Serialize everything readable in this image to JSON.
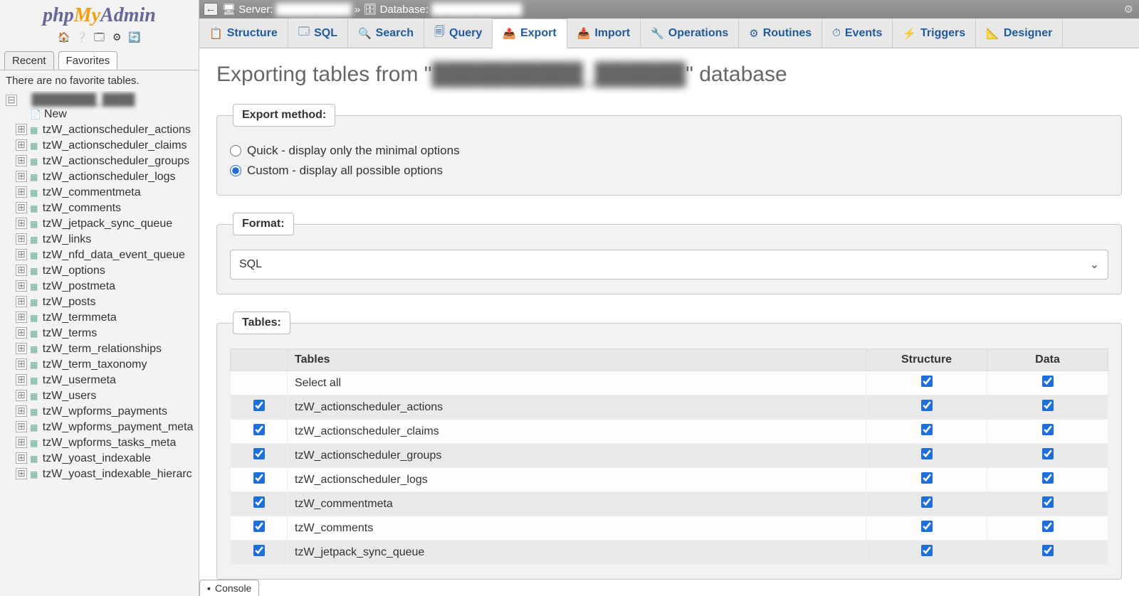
{
  "logo": {
    "part1": "php",
    "part2": "My",
    "part3": "Admin"
  },
  "sidebar": {
    "mini_icons": [
      "home",
      "help",
      "sql",
      "settings",
      "reload"
    ],
    "tabs": {
      "recent": "Recent",
      "favorites": "Favorites"
    },
    "favorites_message": "There are no favorite tables.",
    "db_name_blurred": "████████_████",
    "new_label": "New",
    "tables": [
      "tzW_actionscheduler_actions",
      "tzW_actionscheduler_claims",
      "tzW_actionscheduler_groups",
      "tzW_actionscheduler_logs",
      "tzW_commentmeta",
      "tzW_comments",
      "tzW_jetpack_sync_queue",
      "tzW_links",
      "tzW_nfd_data_event_queue",
      "tzW_options",
      "tzW_postmeta",
      "tzW_posts",
      "tzW_termmeta",
      "tzW_terms",
      "tzW_term_relationships",
      "tzW_term_taxonomy",
      "tzW_usermeta",
      "tzW_users",
      "tzW_wpforms_payments",
      "tzW_wpforms_payment_meta",
      "tzW_wpforms_tasks_meta",
      "tzW_yoast_indexable",
      "tzW_yoast_indexable_hierarc"
    ]
  },
  "breadcrumb": {
    "server_label": "Server:",
    "server_value_blurred": "██████████",
    "separator": "»",
    "database_label": "Database:",
    "database_value_blurred": "████████████"
  },
  "nav": [
    {
      "icon": "📋",
      "label": "Structure"
    },
    {
      "icon": "🗔",
      "label": "SQL"
    },
    {
      "icon": "🔍",
      "label": "Search"
    },
    {
      "icon": "🗐",
      "label": "Query"
    },
    {
      "icon": "📤",
      "label": "Export"
    },
    {
      "icon": "📥",
      "label": "Import"
    },
    {
      "icon": "🔧",
      "label": "Operations"
    },
    {
      "icon": "⚙",
      "label": "Routines"
    },
    {
      "icon": "⏱",
      "label": "Events"
    },
    {
      "icon": "⚡",
      "label": "Triggers"
    },
    {
      "icon": "📐",
      "label": "Designer"
    }
  ],
  "active_tab_index": 4,
  "page": {
    "title_prefix": "Exporting tables from \"",
    "title_db_blurred": "██████████_██████",
    "title_suffix": "\" database"
  },
  "export_method": {
    "legend": "Export method:",
    "quick": "Quick - display only the minimal options",
    "custom": "Custom - display all possible options",
    "selected": "custom"
  },
  "format": {
    "legend": "Format:",
    "value": "SQL"
  },
  "tables_section": {
    "legend": "Tables:",
    "headers": {
      "tables": "Tables",
      "structure": "Structure",
      "data": "Data"
    },
    "select_all": "Select all",
    "rows": [
      {
        "name": "tzW_actionscheduler_actions",
        "sel": true,
        "structure": true,
        "data": true
      },
      {
        "name": "tzW_actionscheduler_claims",
        "sel": true,
        "structure": true,
        "data": true
      },
      {
        "name": "tzW_actionscheduler_groups",
        "sel": true,
        "structure": true,
        "data": true
      },
      {
        "name": "tzW_actionscheduler_logs",
        "sel": true,
        "structure": true,
        "data": true
      },
      {
        "name": "tzW_commentmeta",
        "sel": true,
        "structure": true,
        "data": true
      },
      {
        "name": "tzW_comments",
        "sel": true,
        "structure": true,
        "data": true
      },
      {
        "name": "tzW_jetpack_sync_queue",
        "sel": true,
        "structure": true,
        "data": true
      }
    ],
    "select_all_structure": true,
    "select_all_data": true
  },
  "console": {
    "label": "Console"
  }
}
